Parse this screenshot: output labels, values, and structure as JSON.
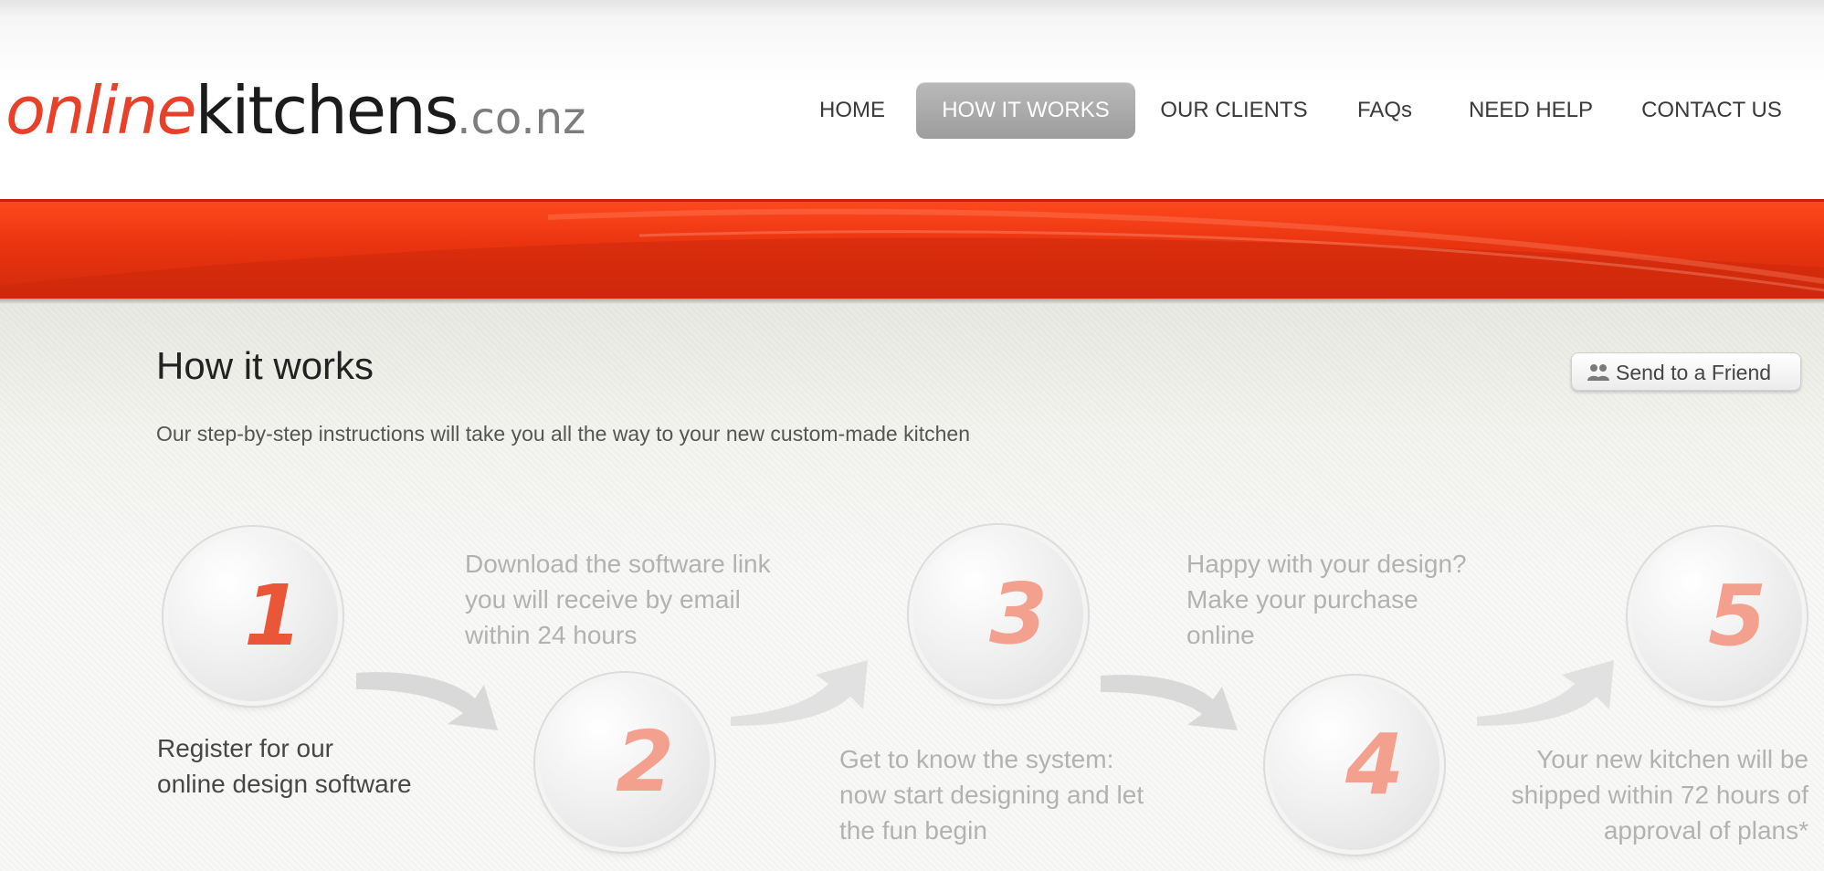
{
  "brand": {
    "logo_online": "online",
    "logo_kitchens": "kitchens",
    "logo_tld": ".co.nz",
    "accent_color": "#e8412a"
  },
  "nav": {
    "items": [
      {
        "label": "HOME",
        "active": false
      },
      {
        "label": "HOW IT WORKS",
        "active": true
      },
      {
        "label": "OUR CLIENTS",
        "active": false
      },
      {
        "label": "FAQs",
        "active": false
      },
      {
        "label": "NEED HELP",
        "active": false
      },
      {
        "label": "CONTACT US",
        "active": false
      }
    ]
  },
  "page": {
    "title": "How it works",
    "subtitle": "Our step-by-step instructions will take you all the way to your new custom-made kitchen",
    "send_to_friend": "Send to a Friend",
    "send_to_friend_icon": "people-icon"
  },
  "steps": [
    {
      "number": "1",
      "lines": [
        "Register for our",
        "online design software"
      ]
    },
    {
      "number": "2",
      "lines": [
        "Download the software link",
        "you will receive by email",
        "within 24 hours"
      ]
    },
    {
      "number": "3",
      "lines": [
        "Get to know the system:",
        "now start designing and let",
        "the fun begin"
      ]
    },
    {
      "number": "4",
      "lines": [
        "Happy with your design?",
        "Make your purchase",
        "online"
      ]
    },
    {
      "number": "5",
      "lines": [
        "Your new kitchen will be",
        "shipped within 72 hours of",
        "approval of plans*"
      ]
    }
  ]
}
